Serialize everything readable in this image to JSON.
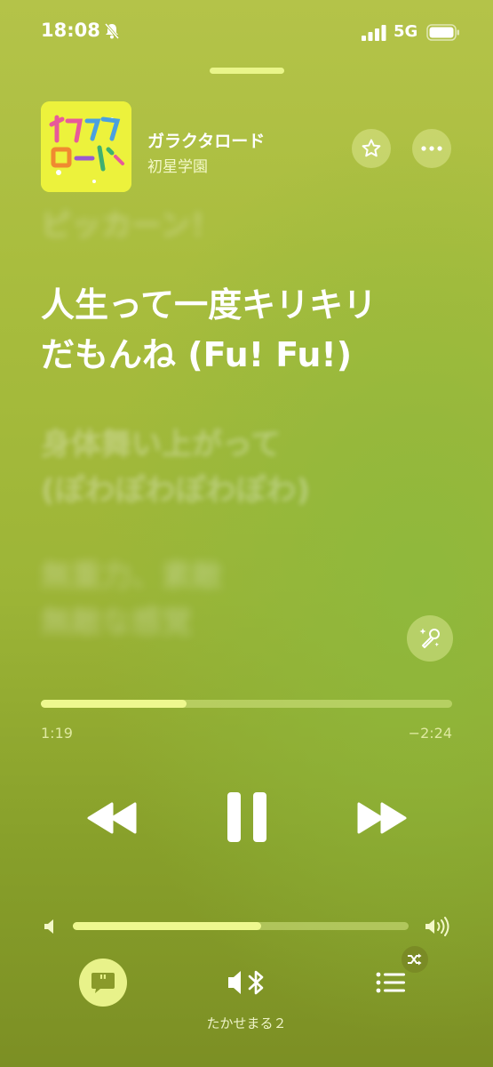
{
  "status_bar": {
    "time": "18:08",
    "network": "5G"
  },
  "now_playing": {
    "title": "ガラクタロード",
    "artist": "初星学園",
    "artwork_text": "ガラクタロード"
  },
  "lyrics": {
    "previous": "ピッカーン！",
    "current_line1": "人生って一度キリキリ",
    "current_line2": "だもんね (Fu! Fu!)",
    "next_line1": "身体舞い上がって",
    "next_line2": "(ぽわぽわぽわぽわ)",
    "next2_line1": "無重力、素敵",
    "next2_line2": "無敵な感覚"
  },
  "progress": {
    "elapsed": "1:19",
    "remaining": "−2:24",
    "fraction": 0.354
  },
  "volume": {
    "fraction": 0.56
  },
  "output_device": "たかせまる２",
  "colors": {
    "accent": "#eef88f",
    "background": "#a3ba3b"
  }
}
